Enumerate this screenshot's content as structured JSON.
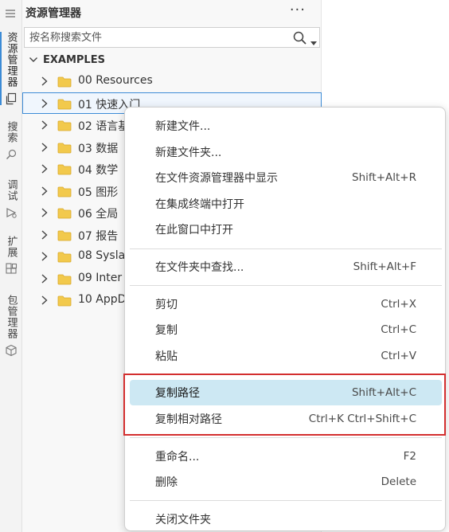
{
  "activity_bar": {
    "items": [
      {
        "label": "资源管理器",
        "icon": "files-icon",
        "active": true
      },
      {
        "label": "搜索",
        "icon": "search-icon",
        "active": false
      },
      {
        "label": "调试",
        "icon": "debug-icon",
        "active": false
      },
      {
        "label": "扩展",
        "icon": "extensions-icon",
        "active": false
      },
      {
        "label": "包管理器",
        "icon": "package-icon",
        "active": false
      }
    ]
  },
  "explorer": {
    "title": "资源管理器",
    "more_label": "···",
    "search": {
      "placeholder": "按名称搜索文件",
      "value": ""
    },
    "root_label": "EXAMPLES",
    "items": [
      {
        "label": "00 Resources"
      },
      {
        "label": "01 快速入门"
      },
      {
        "label": "02 语言基"
      },
      {
        "label": "03 数据"
      },
      {
        "label": "04 数学"
      },
      {
        "label": "05 图形"
      },
      {
        "label": "06 全局"
      },
      {
        "label": "07 报告"
      },
      {
        "label": "08 Sysla"
      },
      {
        "label": "09 Inter"
      },
      {
        "label": "10 AppD"
      }
    ],
    "selected_index": 1
  },
  "context_menu": {
    "groups": [
      [
        {
          "label": "新建文件...",
          "shortcut": ""
        },
        {
          "label": "新建文件夹...",
          "shortcut": ""
        },
        {
          "label": "在文件资源管理器中显示",
          "shortcut": "Shift+Alt+R"
        },
        {
          "label": "在集成终端中打开",
          "shortcut": ""
        },
        {
          "label": "在此窗口中打开",
          "shortcut": ""
        }
      ],
      [
        {
          "label": "在文件夹中查找...",
          "shortcut": "Shift+Alt+F"
        }
      ],
      [
        {
          "label": "剪切",
          "shortcut": "Ctrl+X"
        },
        {
          "label": "复制",
          "shortcut": "Ctrl+C"
        },
        {
          "label": "粘贴",
          "shortcut": "Ctrl+V"
        }
      ],
      [
        {
          "label": "复制路径",
          "shortcut": "Shift+Alt+C"
        },
        {
          "label": "复制相对路径",
          "shortcut": "Ctrl+K Ctrl+Shift+C"
        }
      ],
      [
        {
          "label": "重命名...",
          "shortcut": "F2"
        },
        {
          "label": "删除",
          "shortcut": "Delete"
        }
      ],
      [
        {
          "label": "关闭文件夹",
          "shortcut": ""
        }
      ]
    ],
    "highlighted": "复制路径"
  },
  "colors": {
    "accent": "#3c8bd6",
    "highlight": "#cde8f3",
    "annotation_box": "#d32f2f",
    "folder": "#f2c94c"
  }
}
